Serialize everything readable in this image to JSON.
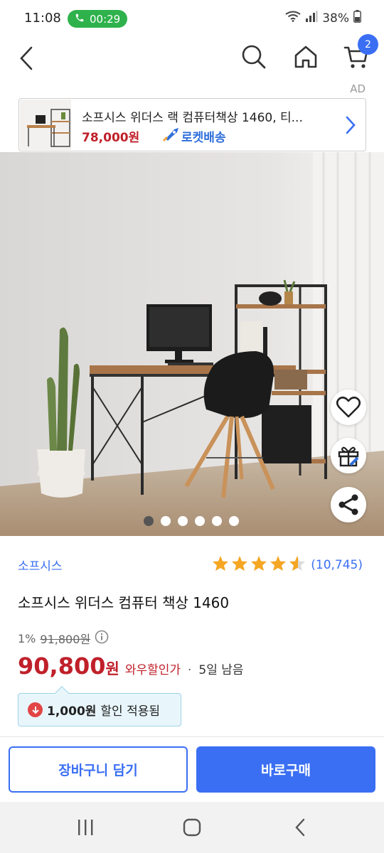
{
  "status": {
    "time": "11:08",
    "call_timer": "00:29",
    "battery": "38%"
  },
  "header": {
    "cart_count": "2",
    "ad_label": "AD"
  },
  "ad": {
    "title": "소프시스 위더스 랙 컴퓨터책상 1460, 티...",
    "price": "78,000원",
    "rocket_label": "로켓배송"
  },
  "product": {
    "brand": "소프시스",
    "rating_count": "(10,745)",
    "rating_stars": 4.5,
    "title": "소프시스 위더스 컴퓨터 책상 1460",
    "discount_percent": "1%",
    "original_price": "91,800원",
    "sale_price": "90,800",
    "sale_unit": "원",
    "wow_label": "와우할인가",
    "separator": "·",
    "time_left": "5일 남음",
    "coupon_amount": "1,000원",
    "coupon_text": "할인 적용됨"
  },
  "gallery": {
    "count": 6,
    "active_index": 0
  },
  "actions": {
    "cart_button": "장바구니 담기",
    "buy_button": "바로구매"
  },
  "colors": {
    "accent": "#3a6ff3",
    "price_red": "#c0202a",
    "call_green": "#2fb24c",
    "star": "#f5a623"
  }
}
